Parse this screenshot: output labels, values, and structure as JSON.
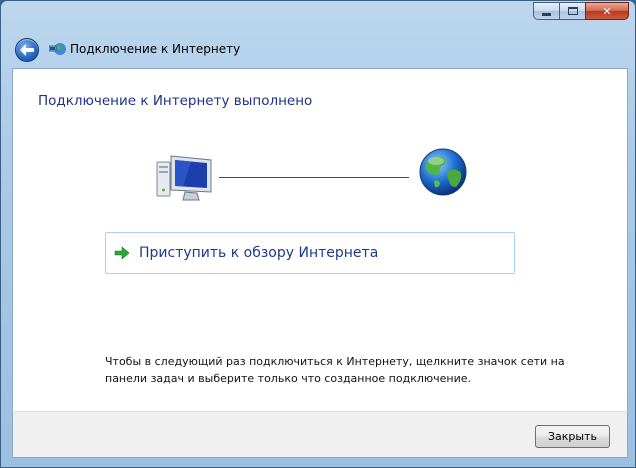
{
  "window": {
    "title": "Подключение к Интернету",
    "caption_buttons": {
      "minimize": "minimize-icon",
      "maximize": "maximize-icon",
      "close": "close-icon"
    }
  },
  "content": {
    "heading": "Подключение к Интернету выполнено",
    "diagram": {
      "left_icon": "computer-icon",
      "right_icon": "globe-icon"
    },
    "browse_link": "Приступить к обзору Интернета",
    "footer_note": "Чтобы в следующий раз подключиться к Интернету, щелкните значок сети на панели задач и выберите только что созданное подключение."
  },
  "buttons": {
    "close_label": "Закрыть"
  },
  "colors": {
    "heading": "#1e3287",
    "link_text": "#1a3b8c",
    "link_border": "#a8d4ea",
    "arrow": "#2ea53a",
    "frame": "#a9c9e6"
  }
}
